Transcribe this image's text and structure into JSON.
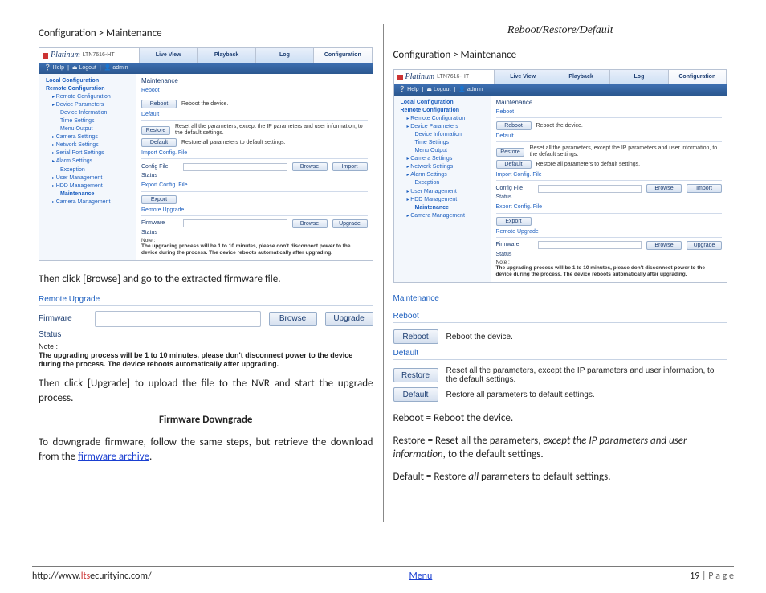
{
  "left": {
    "breadcrumb": "Configuration > Maintenance",
    "after_screenshot": "Then click [Browse] and  go to the extracted firmware file.",
    "after_upgrade": "Then click [Upgrade] to upload the file to the NVR and start the upgrade process.",
    "downgrade_heading": "Firmware Downgrade",
    "downgrade_text_pre": "To downgrade firmware, follow the same steps, but retrieve the download from the ",
    "downgrade_link": "firmware archive",
    "downgrade_text_post": "."
  },
  "right": {
    "title": "Reboot/Restore/Default",
    "breadcrumb": "Configuration > Maintenance",
    "reboot_line": "Reboot = Reboot the device.",
    "restore_pre": "Restore = Reset all the parameters, ",
    "restore_emph": "except the IP parameters and user information",
    "restore_post": ", to the default settings.",
    "default_pre": "Default = Restore ",
    "default_emph": "all",
    "default_post": " parameters to default settings."
  },
  "nvr_common": {
    "brand_script": "Platinum",
    "model": "LTN7616-HT",
    "tabs": {
      "live": "Live View",
      "playback": "Playback",
      "log": "Log",
      "config": "Configuration"
    },
    "helpbar": {
      "help": "Help",
      "logout": "Logout",
      "user": "admin"
    },
    "sidebar": {
      "local": "Local Configuration",
      "remote": "Remote Configuration",
      "remote2": "Remote Configuration",
      "dev_params": "Device Parameters",
      "dev_info": "Device Information",
      "time": "Time Settings",
      "menu_out": "Menu Output",
      "camera": "Camera Settings",
      "network": "Network Settings",
      "serial": "Serial Port Settings",
      "alarm": "Alarm Settings",
      "exception": "Exception",
      "user": "User Management",
      "hdd": "HDD Management",
      "maintenance": "Maintenance",
      "cam_mgmt": "Camera Management"
    },
    "page": {
      "title": "Maintenance",
      "reboot_section": "Reboot",
      "reboot_btn": "Reboot",
      "reboot_desc": "Reboot the device.",
      "default_section": "Default",
      "restore_btn": "Restore",
      "restore_desc": "Reset all the parameters, except the IP parameters and user information, to the default settings.",
      "default_btn": "Default",
      "default_desc": "Restore all parameters to default settings.",
      "import_section": "Import Config. File",
      "config_file": "Config File",
      "status": "Status",
      "browse_btn": "Browse",
      "import_btn": "Import",
      "export_section": "Export Config. File",
      "export_btn": "Export",
      "remote_upgrade": "Remote Upgrade",
      "firmware": "Firmware",
      "upgrade_btn": "Upgrade",
      "note_label": "Note :",
      "note_text": "The upgrading process will be 1 to 10 minutes, please don't disconnect power to the device during the process. The device reboots automatically after upgrading."
    }
  },
  "snippet_upgrade": {
    "heading": "Remote Upgrade",
    "firmware": "Firmware",
    "status": "Status",
    "browse": "Browse",
    "upgrade": "Upgrade",
    "note_label": "Note :",
    "note_text": "The upgrading process will be 1 to 10 minutes, please don't disconnect power to the device during the process. The device reboots automatically after upgrading."
  },
  "maint_snippet": {
    "title": "Maintenance",
    "reboot_sub": "Reboot",
    "reboot_btn": "Reboot",
    "reboot_desc": "Reboot the device.",
    "default_sub": "Default",
    "restore_btn": "Restore",
    "restore_desc": "Reset all the parameters, except the IP parameters and user information, to the default settings.",
    "default_btn": "Default",
    "default_desc": "Restore all parameters to default settings."
  },
  "footer": {
    "url_pre": "http://www.",
    "url_red": "lts",
    "url_post": "ecurityinc.com/",
    "menu": "Menu",
    "page_number": "19",
    "page_word": " | P a g e"
  }
}
